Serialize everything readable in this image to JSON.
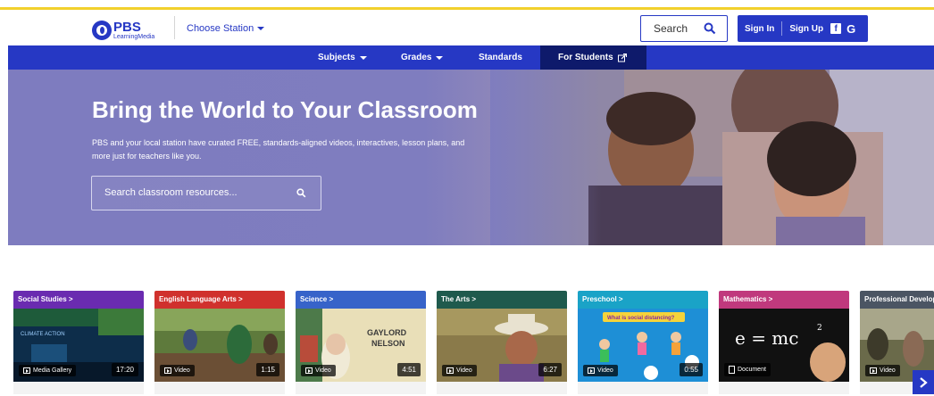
{
  "brand": {
    "name": "PBS",
    "sub": "LearningMedia"
  },
  "header": {
    "station_label": "Choose Station",
    "search_label": "Search",
    "sign_in": "Sign In",
    "sign_up": "Sign Up",
    "facebook_glyph": "f",
    "google_glyph": "G"
  },
  "nav": {
    "items": [
      {
        "label": "Subjects"
      },
      {
        "label": "Grades"
      },
      {
        "label": "Standards"
      },
      {
        "label": "For Students"
      }
    ]
  },
  "hero": {
    "title": "Bring the World to Your Classroom",
    "subtitle": "PBS and your local station have curated FREE, standards-aligned videos, interactives, lesson plans, and more just for teachers like you.",
    "search_placeholder": "Search classroom resources..."
  },
  "cards": [
    {
      "category": "Social Studies >",
      "type": "Media Gallery",
      "duration": "17:20",
      "color": "#6a2bb0"
    },
    {
      "category": "English Language Arts >",
      "type": "Video",
      "duration": "1:15",
      "color": "#d0312d"
    },
    {
      "category": "Science >",
      "type": "Video",
      "duration": "4:51",
      "color": "#3763c9"
    },
    {
      "category": "The Arts >",
      "type": "Video",
      "duration": "6:27",
      "color": "#1f5a4d"
    },
    {
      "category": "Preschool >",
      "type": "Video",
      "duration": "0:55",
      "color": "#1aa3c7"
    },
    {
      "category": "Mathematics >",
      "type": "Document",
      "duration": "",
      "color": "#c0397d"
    },
    {
      "category": "Professional Development >",
      "type": "Video",
      "duration": "",
      "color": "#4b5563"
    }
  ],
  "thumb_text": {
    "climate": "CLIMATE ACTION",
    "gaylord": "GAYLORD",
    "nelson": "NELSON",
    "distancing": "What is social distancing?",
    "formula": "e = mc"
  },
  "colors": {
    "brand_blue": "#2638c4",
    "nav_active": "#0e1a6b",
    "top_line": "#f2d12c"
  }
}
